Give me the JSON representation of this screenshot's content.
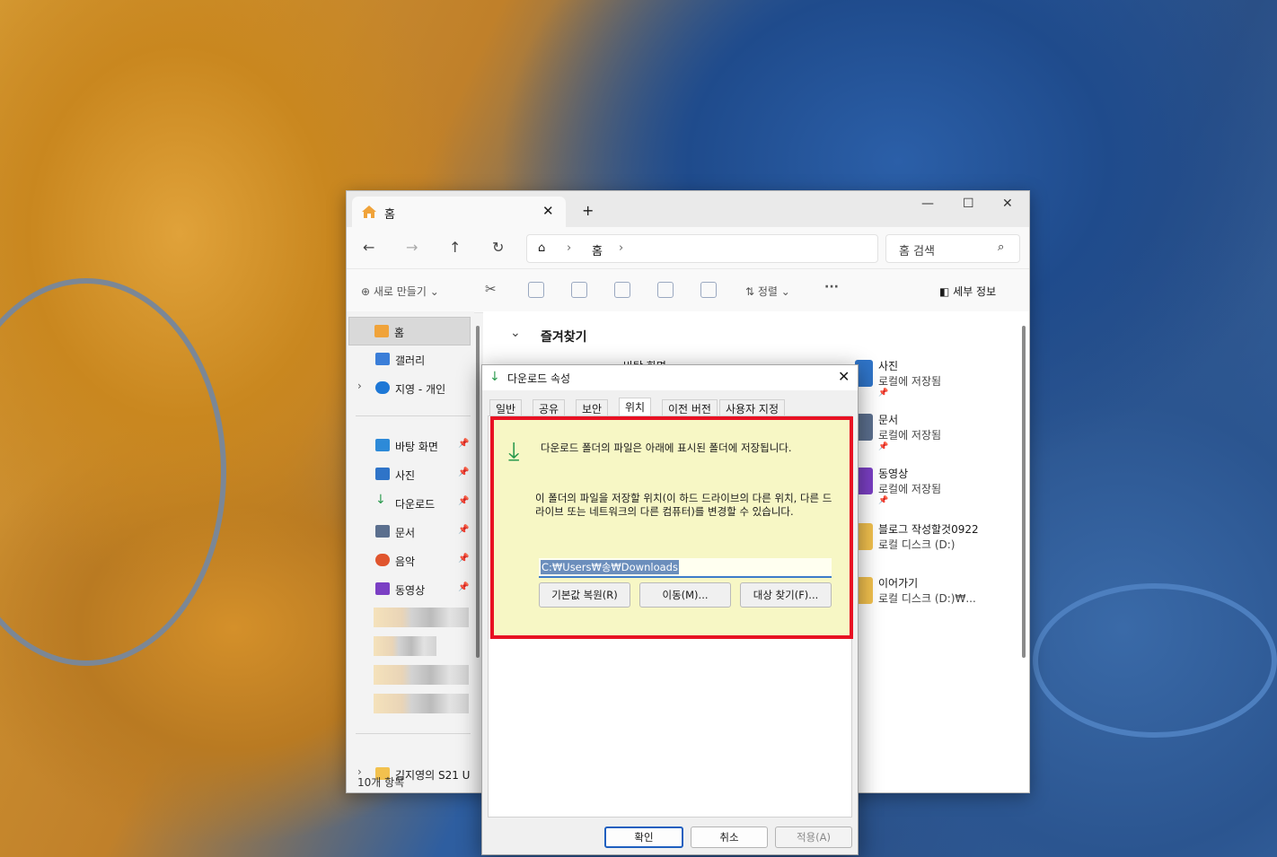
{
  "explorer": {
    "tab_title": "홈",
    "address": [
      "홈"
    ],
    "search_placeholder": "홈 검색",
    "toolbar": {
      "new": "새로 만들기",
      "sort": "정렬",
      "details": "세부 정보"
    },
    "sidebar": {
      "items": [
        {
          "label": "홈"
        },
        {
          "label": "갤러리"
        },
        {
          "label": "지영 - 개인"
        },
        {
          "label": "바탕 화면"
        },
        {
          "label": "사진"
        },
        {
          "label": "다운로드"
        },
        {
          "label": "문서"
        },
        {
          "label": "음악"
        },
        {
          "label": "동영상"
        },
        {
          "label": "김지영의 S21 U"
        }
      ]
    },
    "section_title": "즐겨찾기",
    "partial_item": "바탕 화면",
    "quick_access": [
      {
        "name": "사진",
        "sub": "로컬에 저장됨"
      },
      {
        "name": "문서",
        "sub": "로컬에 저장됨"
      },
      {
        "name": "동영상",
        "sub": "로컬에 저장됨"
      },
      {
        "name": "블로그 작성할것0922",
        "sub": "로컬 디스크 (D:)"
      },
      {
        "name": "이어가기",
        "sub": "로컬 디스크 (D:)₩..."
      }
    ],
    "status": "10개 항목"
  },
  "dialog": {
    "title": "다운로드 속성",
    "tabs": [
      "일반",
      "공유",
      "보안",
      "위치",
      "이전 버전",
      "사용자 지정"
    ],
    "active_tab": "위치",
    "desc1": "다운로드 폴더의 파일은 아래에 표시된 폴더에 저장됩니다.",
    "desc2": "이 폴더의 파일을 저장할 위치(이 하드 드라이브의 다른 위치, 다른 드라이브 또는 네트워크의 다른 컴퓨터)를 변경할 수 있습니다.",
    "path": "C:₩Users₩송₩Downloads",
    "buttons": {
      "restore": "기본값 복원(R)",
      "move": "이동(M)...",
      "find": "대상 찾기(F)..."
    },
    "footer": {
      "ok": "확인",
      "cancel": "취소",
      "apply": "적용(A)"
    }
  },
  "colors": {
    "highlight_border": "#e81123",
    "highlight_fill": "#f7f7c5",
    "accent": "#1f5fbf"
  }
}
